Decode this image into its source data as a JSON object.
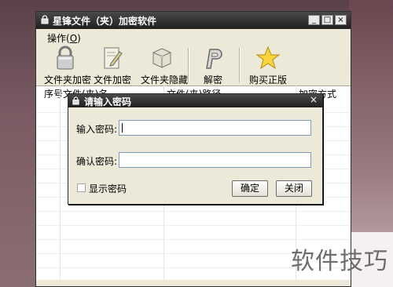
{
  "window": {
    "title": "星锋文件（夹）加密软件",
    "controls": [
      "_",
      "□",
      "×"
    ]
  },
  "menu": {
    "operate_label": "操作(",
    "operate_key": "O",
    "operate_end": ")"
  },
  "toolbar": {
    "items": [
      {
        "label": "文件夹加密",
        "icon": "padlock-icon"
      },
      {
        "label": "文件加密",
        "icon": "document-pen-icon"
      },
      {
        "label": "文件夹隐藏",
        "icon": "box-icon"
      },
      {
        "label": "解密",
        "icon": "p-key-icon"
      },
      {
        "label": "购买正版",
        "icon": "star-icon"
      }
    ]
  },
  "list": {
    "columns": [
      "序号",
      "文件(夹)名",
      "文件(夹)路径",
      "加密方式"
    ]
  },
  "dialog": {
    "title": "请输入密码",
    "close": "×",
    "password_label": "输入密码:",
    "password_value": "",
    "confirm_label": "确认密码:",
    "confirm_value": "",
    "show_password_label": "显示密码",
    "show_password_checked": false,
    "ok_label": "确定",
    "close_label": "关闭"
  },
  "watermark": "软件技巧"
}
